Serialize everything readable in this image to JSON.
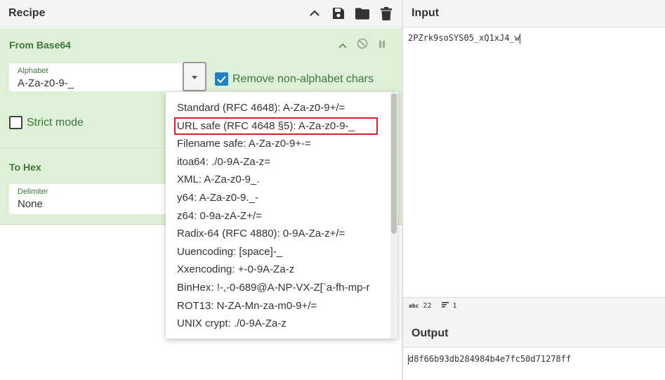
{
  "recipe": {
    "title": "Recipe"
  },
  "operations": [
    {
      "name": "From Base64",
      "alphabet_label": "Alphabet",
      "alphabet_value": "A-Za-z0-9-_",
      "remove_non_alphabet_label": "Remove non-alphabet chars",
      "remove_non_alphabet_checked": true,
      "strict_mode_label": "Strict mode",
      "strict_mode_checked": false
    },
    {
      "name": "To Hex",
      "delimiter_label": "Delimiter",
      "delimiter_value": "None"
    }
  ],
  "alphabet_menu": {
    "options": [
      "Standard (RFC 4648): A-Za-z0-9+/=",
      "URL safe (RFC 4648 §5): A-Za-z0-9-_",
      "Filename safe: A-Za-z0-9+-=",
      "itoa64: ./0-9A-Za-z=",
      "XML: A-Za-z0-9_.",
      "y64: A-Za-z0-9._-",
      "z64: 0-9a-zA-Z+/=",
      "Radix-64 (RFC 4880): 0-9A-Za-z+/=",
      "Uuencoding: [space]-_",
      "Xxencoding: +-0-9A-Za-z",
      "BinHex: !-,-0-689@A-NP-VX-Z[`a-fh-mp-r",
      "ROT13: N-ZA-Mn-za-m0-9+/=",
      "UNIX crypt: ./0-9A-Za-z"
    ],
    "selected_index": 1
  },
  "input": {
    "title": "Input",
    "text": "2PZrk9soSYS05_xQ1xJ4_w",
    "status_length_label": "abc",
    "status_length": "22",
    "status_lines": "1"
  },
  "output": {
    "title": "Output",
    "text": "d8f66b93db284984b4e7fc50d71278ff"
  },
  "colors": {
    "operation_bg": "#dff0d8",
    "operation_text": "#3c763d",
    "checkbox_accent": "#2280c3",
    "highlight_box": "#e02020"
  }
}
